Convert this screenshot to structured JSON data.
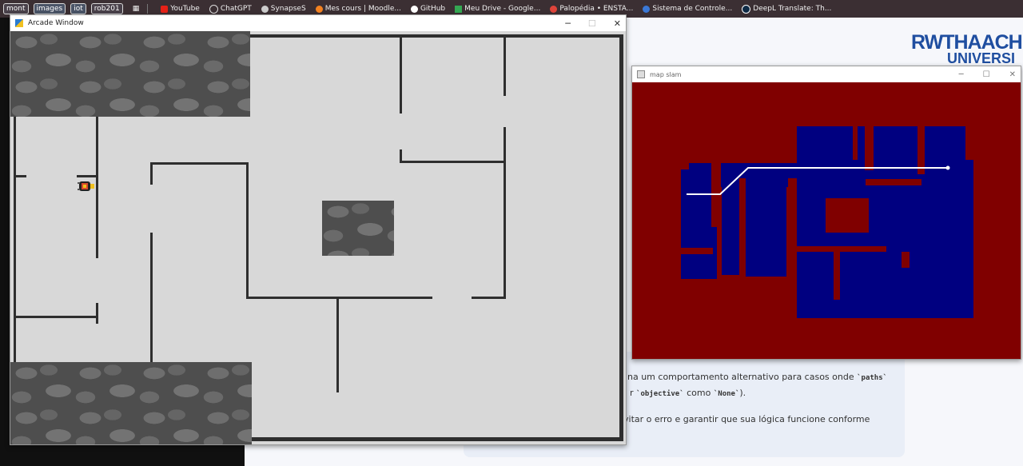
{
  "bookmarks": {
    "tags": [
      "mont",
      "images",
      "iot",
      "rob201"
    ],
    "links": [
      {
        "label": "YouTube",
        "icon": "youtube-icon",
        "color": "#e62117"
      },
      {
        "label": "ChatGPT",
        "icon": "chatgpt-icon",
        "color": "#dddddd"
      },
      {
        "label": "SynapseS",
        "icon": "synapses-icon",
        "color": "#cccccc"
      },
      {
        "label": "Mes cours | Moodle...",
        "icon": "moodle-icon",
        "color": "#f58220"
      },
      {
        "label": "GitHub",
        "icon": "github-icon",
        "color": "#ffffff"
      },
      {
        "label": "Meu Drive - Google...",
        "icon": "drive-icon",
        "color": "#34a853"
      },
      {
        "label": "Palopédia • ENSTA...",
        "icon": "palopedia-icon",
        "color": "#e0443a"
      },
      {
        "label": "Sistema de Controle...",
        "icon": "sistema-icon",
        "color": "#3a78d6"
      },
      {
        "label": "DeepL Translate: Th...",
        "icon": "deepl-icon",
        "color": "#0f2b46"
      }
    ]
  },
  "arcade_window": {
    "title": "Arcade Window",
    "controls": {
      "minimize": "─",
      "maximize": "☐",
      "close": "✕"
    }
  },
  "map_window": {
    "title": "map slam",
    "controls": {
      "minimize": "─",
      "maximize": "☐",
      "close": "✕"
    },
    "colors": {
      "unknown": "#800000",
      "free": "#000080",
      "path": "#ffffff"
    }
  },
  "background_page": {
    "logo_line1": "RWTHAACHEN",
    "logo_line2": "UNIVERSI",
    "text_line1_prefix": "na um comportamento alternativo para casos onde ",
    "text_line1_code": "`paths`",
    "text_line2_prefix": "r ",
    "text_line2_code1": "`objective`",
    "text_line2_mid": " como ",
    "text_line2_code2": "`None`",
    "text_line2_suffix": ").",
    "text_line3": "vitar o erro e garantir que sua lógica funcione conforme"
  }
}
